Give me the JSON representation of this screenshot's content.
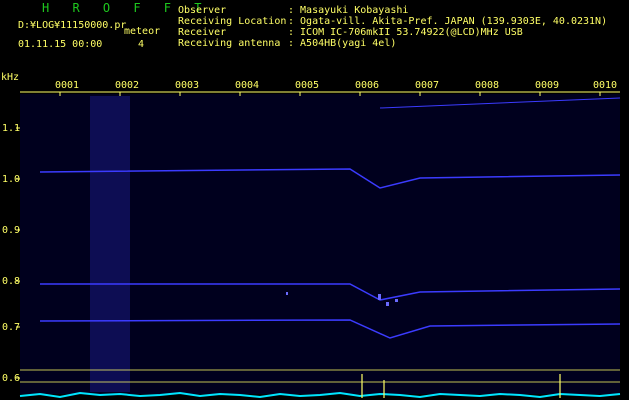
{
  "app": {
    "title": "H R O F F T",
    "file_path": "D:¥LOG¥11150000.pr",
    "mode": "meteor",
    "datetime": "01.11.15 00:00",
    "count": "4"
  },
  "header": {
    "rows": [
      {
        "key": "Observer",
        "value": ": Masayuki Kobayashi"
      },
      {
        "key": "Receiving Location",
        "value": ": Ogata-vill. Akita-Pref. JAPAN (139.9303E, 40.0231N)"
      },
      {
        "key": "Receiver",
        "value": ": ICOM IC-706mkII 53.74922(@LCD)MHz USB"
      },
      {
        "key": "Receiving antenna",
        "value": ": A504HB(yagi 4el)"
      }
    ]
  },
  "axes": {
    "y_unit": "kHz",
    "y_ticks": [
      "1.1",
      "1.0",
      "0.9",
      "0.8",
      "0.7",
      "0.6"
    ],
    "x_ticks": [
      "0001",
      "0002",
      "0003",
      "0004",
      "0005",
      "0006",
      "0007",
      "0008",
      "0009",
      "0010"
    ]
  },
  "colors": {
    "background": "#000000",
    "spectrum_bg": "#00001e",
    "text": "#ffff66",
    "title": "#1ec81e",
    "trace": "#3b3bff",
    "noise_floor": "#00e5ff"
  }
}
